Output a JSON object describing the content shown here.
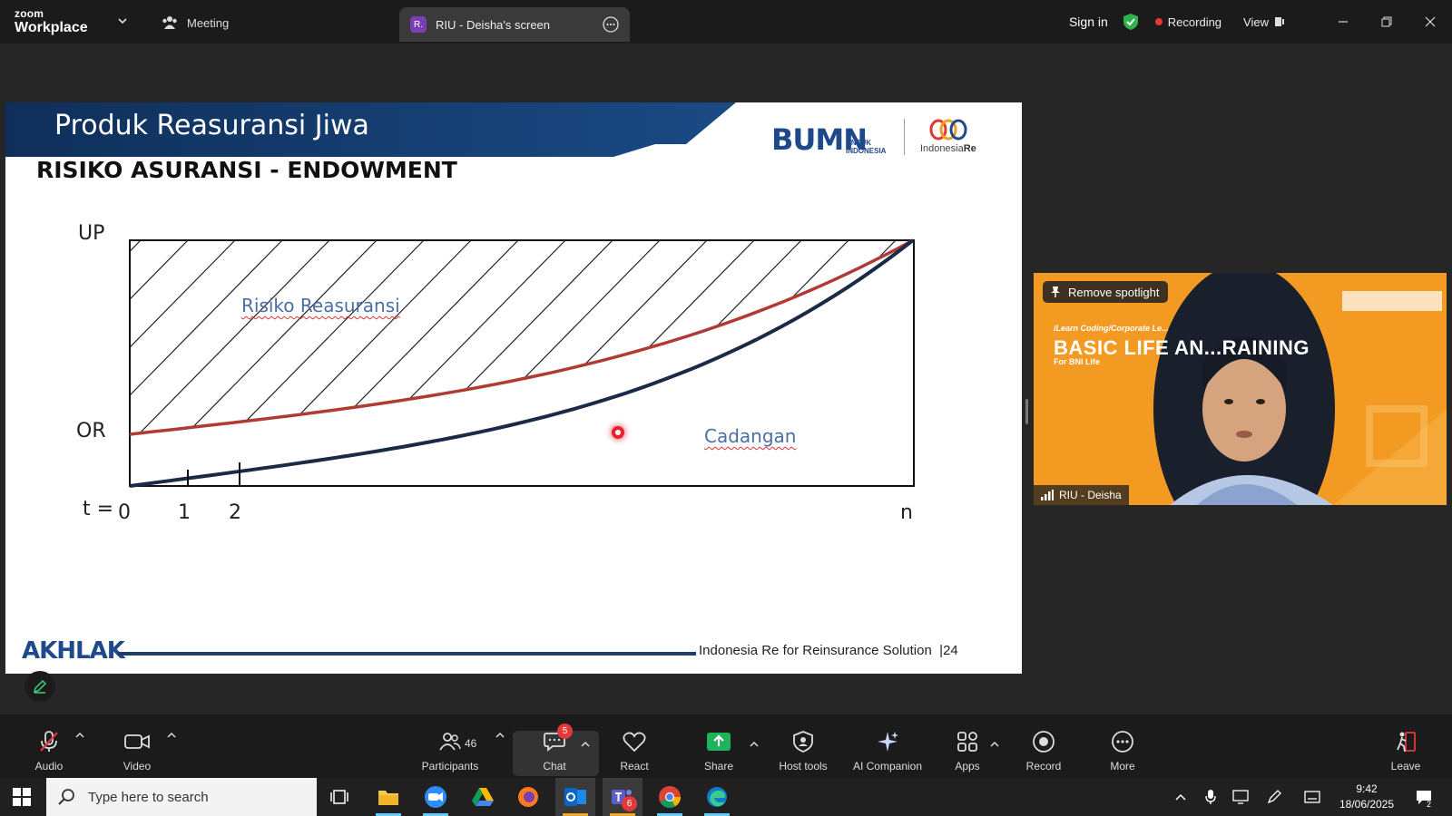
{
  "app": {
    "brand_top": "zoom",
    "brand_bottom": "Workplace",
    "meeting_tab": "Meeting",
    "screen_tab_badge": "R.",
    "screen_tab": "RIU - Deisha's screen",
    "sign_in": "Sign in",
    "recording": "Recording",
    "view": "View"
  },
  "slide": {
    "header_title": "Produk Reasuransi Jiwa",
    "subtitle": "RISIKO ASURANSI - ENDOWMENT",
    "bumn_logo": "BUMN",
    "bumn_sub_1": "UNTUK",
    "bumn_sub_2": "INDONESIA",
    "indre_logo_1": "Indonesia",
    "indre_logo_2": "Re",
    "footer_brand": "AKHLAK",
    "footer_text": "Indonesia Re for Reinsurance Solution",
    "page_number": "|24",
    "colors": {
      "header_blue": "#123a6b",
      "reserve_line": "#1b2a46",
      "risk_line": "#b03a34"
    }
  },
  "chart_data": {
    "type": "line",
    "y_labels": [
      "UP",
      "OR"
    ],
    "x_prefix": "t =",
    "x_ticks": [
      "0",
      "1",
      "2",
      "n"
    ],
    "series": [
      {
        "name": "",
        "kind": "risk-line",
        "color": "#b03a34",
        "start": "OR",
        "end": "UP"
      },
      {
        "name": "",
        "kind": "reserve-line",
        "color": "#1b2a46",
        "start": "0",
        "end": "UP"
      }
    ],
    "annotations": [
      "Risiko Reasuransi",
      "Cadangan"
    ]
  },
  "video": {
    "spotlight_button": "Remove spotlight",
    "banner_small": "iLearn Coding/Corporate Le...",
    "banner_title": "BASIC LIFE AN...RAINING",
    "banner_sub": "For BNI Life",
    "participant_name": "RIU - Deisha"
  },
  "toolbar": {
    "audio": "Audio",
    "video": "Video",
    "participants": "Participants",
    "participants_count": "46",
    "chat": "Chat",
    "chat_badge": "5",
    "react": "React",
    "share": "Share",
    "host_tools": "Host tools",
    "ai_companion": "AI Companion",
    "apps": "Apps",
    "record": "Record",
    "more": "More",
    "leave": "Leave"
  },
  "taskbar": {
    "search_placeholder": "Type here to search",
    "teams_badge": "6",
    "time": "9:42",
    "date": "18/06/2025",
    "notification_count": "2"
  }
}
